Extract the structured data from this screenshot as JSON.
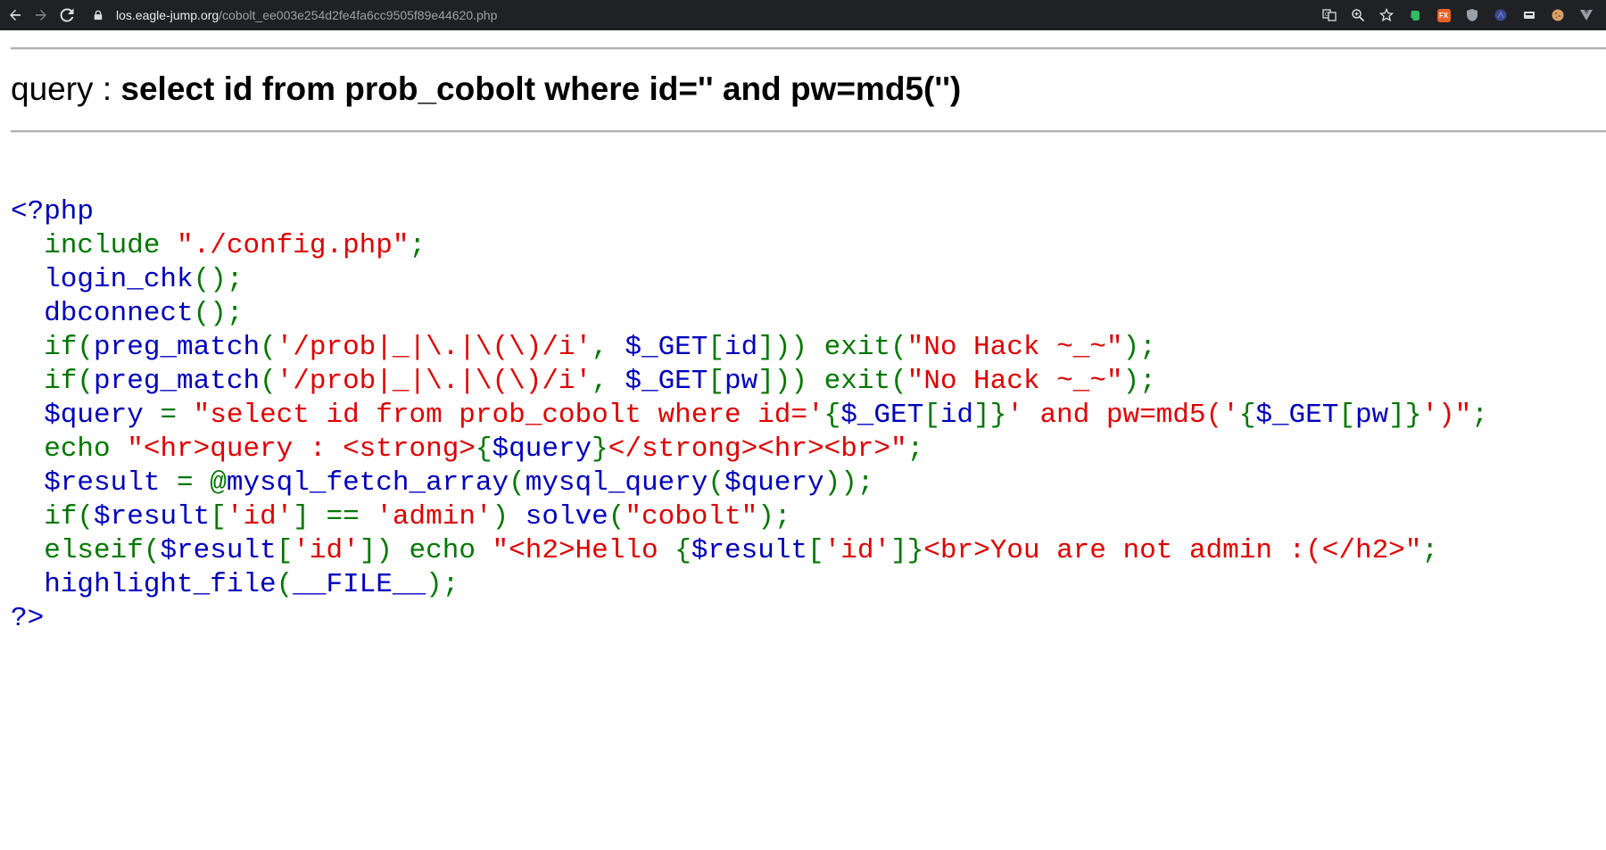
{
  "browser": {
    "url_host": "los.eagle-jump.org",
    "url_path": "/cobolt_ee003e254d2fe4fa6cc9505f89e44620.php",
    "extensions": [
      {
        "icon": "evernote-icon",
        "color": "#2dbe60"
      },
      {
        "icon": "fx-extension-icon",
        "color": "#e8622a",
        "label": "FX"
      },
      {
        "icon": "ublock-shield-icon",
        "color": "#9aa0a6"
      },
      {
        "icon": "proxy-extension-icon",
        "color": "#3c4a8f"
      },
      {
        "icon": "screen-capture-icon",
        "color": "#dadce0"
      },
      {
        "icon": "cookie-icon",
        "color": "#d9a066"
      },
      {
        "icon": "vue-devtools-icon",
        "color": "#9aa0a6"
      }
    ]
  },
  "page": {
    "query_label": "query : ",
    "query_text": "select id from prob_cobolt where id='' and pw=md5('')"
  },
  "code": {
    "lines": [
      [
        {
          "c": "df",
          "t": "<?php"
        }
      ],
      [
        {
          "c": "df",
          "t": "  "
        },
        {
          "c": "kw",
          "t": "include "
        },
        {
          "c": "st",
          "t": "\"./config.php\""
        },
        {
          "c": "kw",
          "t": ";"
        }
      ],
      [
        {
          "c": "df",
          "t": "  login_chk"
        },
        {
          "c": "kw",
          "t": "();"
        }
      ],
      [
        {
          "c": "df",
          "t": "  dbconnect"
        },
        {
          "c": "kw",
          "t": "();"
        }
      ],
      [
        {
          "c": "df",
          "t": "  "
        },
        {
          "c": "kw",
          "t": "if("
        },
        {
          "c": "df",
          "t": "preg_match"
        },
        {
          "c": "kw",
          "t": "("
        },
        {
          "c": "st",
          "t": "'/prob|_|\\.|\\(\\)/i'"
        },
        {
          "c": "kw",
          "t": ", "
        },
        {
          "c": "df",
          "t": "$_GET"
        },
        {
          "c": "kw",
          "t": "["
        },
        {
          "c": "df",
          "t": "id"
        },
        {
          "c": "kw",
          "t": "])) exit("
        },
        {
          "c": "st",
          "t": "\"No Hack ~_~\""
        },
        {
          "c": "kw",
          "t": ");"
        }
      ],
      [
        {
          "c": "df",
          "t": "  "
        },
        {
          "c": "kw",
          "t": "if("
        },
        {
          "c": "df",
          "t": "preg_match"
        },
        {
          "c": "kw",
          "t": "("
        },
        {
          "c": "st",
          "t": "'/prob|_|\\.|\\(\\)/i'"
        },
        {
          "c": "kw",
          "t": ", "
        },
        {
          "c": "df",
          "t": "$_GET"
        },
        {
          "c": "kw",
          "t": "["
        },
        {
          "c": "df",
          "t": "pw"
        },
        {
          "c": "kw",
          "t": "])) exit("
        },
        {
          "c": "st",
          "t": "\"No Hack ~_~\""
        },
        {
          "c": "kw",
          "t": ");"
        }
      ],
      [
        {
          "c": "df",
          "t": "  $query "
        },
        {
          "c": "kw",
          "t": "= "
        },
        {
          "c": "st",
          "t": "\"select id from prob_cobolt where id='"
        },
        {
          "c": "kw",
          "t": "{"
        },
        {
          "c": "df",
          "t": "$_GET"
        },
        {
          "c": "kw",
          "t": "["
        },
        {
          "c": "df",
          "t": "id"
        },
        {
          "c": "kw",
          "t": "]}"
        },
        {
          "c": "st",
          "t": "' and pw=md5('"
        },
        {
          "c": "kw",
          "t": "{"
        },
        {
          "c": "df",
          "t": "$_GET"
        },
        {
          "c": "kw",
          "t": "["
        },
        {
          "c": "df",
          "t": "pw"
        },
        {
          "c": "kw",
          "t": "]}"
        },
        {
          "c": "st",
          "t": "')\""
        },
        {
          "c": "kw",
          "t": ";"
        }
      ],
      [
        {
          "c": "df",
          "t": "  "
        },
        {
          "c": "kw",
          "t": "echo "
        },
        {
          "c": "st",
          "t": "\"<hr>query : <strong>"
        },
        {
          "c": "kw",
          "t": "{"
        },
        {
          "c": "df",
          "t": "$query"
        },
        {
          "c": "kw",
          "t": "}"
        },
        {
          "c": "st",
          "t": "</strong><hr><br>\""
        },
        {
          "c": "kw",
          "t": ";"
        }
      ],
      [
        {
          "c": "df",
          "t": "  $result "
        },
        {
          "c": "kw",
          "t": "= @"
        },
        {
          "c": "df",
          "t": "mysql_fetch_array"
        },
        {
          "c": "kw",
          "t": "("
        },
        {
          "c": "df",
          "t": "mysql_query"
        },
        {
          "c": "kw",
          "t": "("
        },
        {
          "c": "df",
          "t": "$query"
        },
        {
          "c": "kw",
          "t": "));"
        }
      ],
      [
        {
          "c": "df",
          "t": "  "
        },
        {
          "c": "kw",
          "t": "if("
        },
        {
          "c": "df",
          "t": "$result"
        },
        {
          "c": "kw",
          "t": "["
        },
        {
          "c": "st",
          "t": "'id'"
        },
        {
          "c": "kw",
          "t": "] == "
        },
        {
          "c": "st",
          "t": "'admin'"
        },
        {
          "c": "kw",
          "t": ") "
        },
        {
          "c": "df",
          "t": "solve"
        },
        {
          "c": "kw",
          "t": "("
        },
        {
          "c": "st",
          "t": "\"cobolt\""
        },
        {
          "c": "kw",
          "t": ");"
        }
      ],
      [
        {
          "c": "df",
          "t": "  "
        },
        {
          "c": "kw",
          "t": "elseif("
        },
        {
          "c": "df",
          "t": "$result"
        },
        {
          "c": "kw",
          "t": "["
        },
        {
          "c": "st",
          "t": "'id'"
        },
        {
          "c": "kw",
          "t": "]) echo "
        },
        {
          "c": "st",
          "t": "\"<h2>Hello "
        },
        {
          "c": "kw",
          "t": "{"
        },
        {
          "c": "df",
          "t": "$result"
        },
        {
          "c": "kw",
          "t": "["
        },
        {
          "c": "st",
          "t": "'id'"
        },
        {
          "c": "kw",
          "t": "]}"
        },
        {
          "c": "st",
          "t": "<br>You are not admin :(</h2>\""
        },
        {
          "c": "kw",
          "t": ";"
        }
      ],
      [
        {
          "c": "df",
          "t": "  highlight_file"
        },
        {
          "c": "kw",
          "t": "("
        },
        {
          "c": "df",
          "t": "__FILE__"
        },
        {
          "c": "kw",
          "t": ");"
        }
      ],
      [
        {
          "c": "df",
          "t": "?>"
        }
      ]
    ]
  }
}
